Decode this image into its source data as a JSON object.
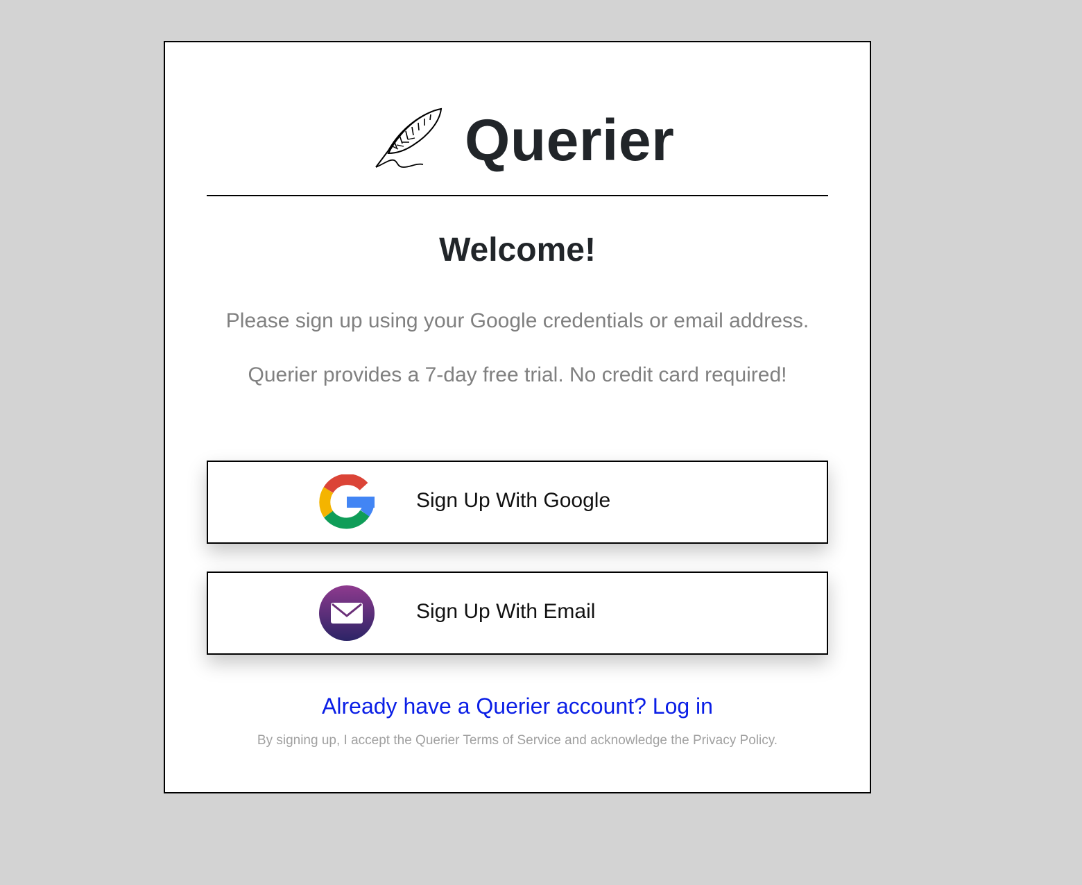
{
  "brand": {
    "name": "Querier",
    "logo_icon": "quill-feather-icon"
  },
  "welcome": {
    "title": "Welcome!",
    "instructions": "Please sign up using your Google credentials or email address.",
    "trial_note": "Querier provides a 7-day free trial. No credit card required!"
  },
  "buttons": {
    "google": {
      "label": "Sign Up With Google",
      "icon": "google-g-icon"
    },
    "email": {
      "label": "Sign Up With Email",
      "icon": "envelope-icon"
    }
  },
  "login_link": "Already have a Querier account? Log in",
  "legal": "By signing up, I accept the Querier Terms of Service and acknowledge the Privacy Policy.",
  "colors": {
    "page_background": "#d3d3d3",
    "heading_text": "#212529",
    "muted_text": "#808080",
    "link": "#0a1ee6",
    "legal_text": "#a0a0a0",
    "google_red": "#db4437",
    "google_yellow": "#f4b400",
    "google_green": "#0f9d58",
    "google_blue": "#4285f4",
    "email_gradient_top": "#8e3a8e",
    "email_gradient_bottom": "#2c2466"
  }
}
